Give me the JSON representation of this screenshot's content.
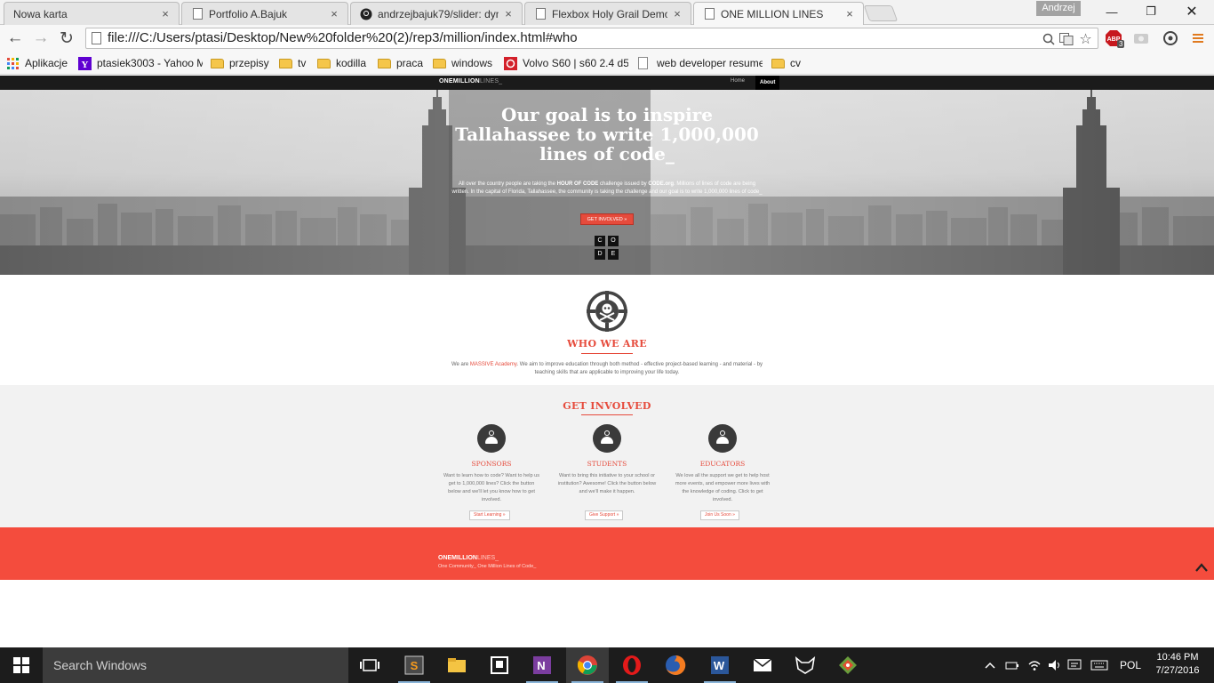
{
  "browser": {
    "tabs": [
      {
        "title": "Nowa karta",
        "close": "×"
      },
      {
        "title": "Portfolio A.Bajuk",
        "close": "×"
      },
      {
        "title": "andrzejbajuk79/slider: dyn",
        "close": "×"
      },
      {
        "title": "Flexbox Holy Grail Demo",
        "close": "×"
      },
      {
        "title": "ONE MILLION LINES",
        "close": "×"
      }
    ],
    "user": "Andrzej",
    "url": "file:///C:/Users/ptasi/Desktop/New%20folder%20(2)/rep3/million/index.html#who",
    "abp_count": "3",
    "bookmarks": [
      {
        "label": "Aplikacje",
        "icon": "apps-grid-icon"
      },
      {
        "label": "ptasiek3003 - Yahoo M",
        "icon": "yahoo-icon"
      },
      {
        "label": "przepisy",
        "icon": "folder-icon"
      },
      {
        "label": "tv",
        "icon": "folder-icon"
      },
      {
        "label": "kodilla",
        "icon": "folder-icon"
      },
      {
        "label": "praca",
        "icon": "folder-icon"
      },
      {
        "label": "windows",
        "icon": "folder-icon"
      },
      {
        "label": "Volvo S60 | s60 2.4 d5",
        "icon": "volvo-icon"
      },
      {
        "label": "web developer resume",
        "icon": "page-icon"
      },
      {
        "label": "cv",
        "icon": "folder-icon"
      }
    ]
  },
  "site": {
    "logo_bold": "ONEMILLION",
    "logo_light": "LINES_",
    "nav": {
      "home": "Home",
      "about": "About"
    },
    "hero": {
      "title": "Our goal is to inspire Tallahassee to write 1,000,000 lines of code_",
      "text_1": "All over the country people are taking the ",
      "text_hour": "HOUR OF CODE",
      "text_2": " challenge issued by ",
      "text_code": "CODE.org",
      "text_3": ". Millions of lines of code are being written. In the capital of Florida, Tallahassee, the community is taking the challenge and our goal is to write 1,000,000 lines of code_",
      "button": "GET INVOLVED »",
      "code_letters": [
        "C",
        "O",
        "D",
        "E"
      ]
    },
    "who": {
      "title": "WHO WE ARE",
      "text_1": "We are ",
      "highlight": "MASSIVE Academy",
      "text_2": ". We aim to improve education through both method - effective project-based learning - and material - by teaching skills that are applicable to improving your life today."
    },
    "involved": {
      "title": "GET INVOLVED",
      "columns": [
        {
          "name": "SPONSORS",
          "desc": "Want to learn how to code? Want to help us get to 1,000,000 lines? Click the button below and we'll let you know how to get involved.",
          "button": "Start Learning »"
        },
        {
          "name": "STUDENTS",
          "desc": "Want to bring this initiative to your school or institution? Awesome! Click the button below and we'll make it happen.",
          "button": "Give Support »"
        },
        {
          "name": "EDUCATORS",
          "desc": "We love all the support we get to help host more events, and empower more lives with the knowledge of coding. Click to get involved.",
          "button": "Join Us Soon »"
        }
      ]
    },
    "footer": {
      "logo_bold": "ONEMILLION",
      "logo_light": "LINES_",
      "tagline": "One Community_ One Million Lines of Code_"
    },
    "colors": {
      "accent": "#e64b3c",
      "footer": "#f44c3d",
      "nav": "#1b1b1b"
    }
  },
  "taskbar": {
    "search_placeholder": "Search Windows",
    "language": "POL",
    "time": "10:46 PM",
    "date": "7/27/2016"
  }
}
